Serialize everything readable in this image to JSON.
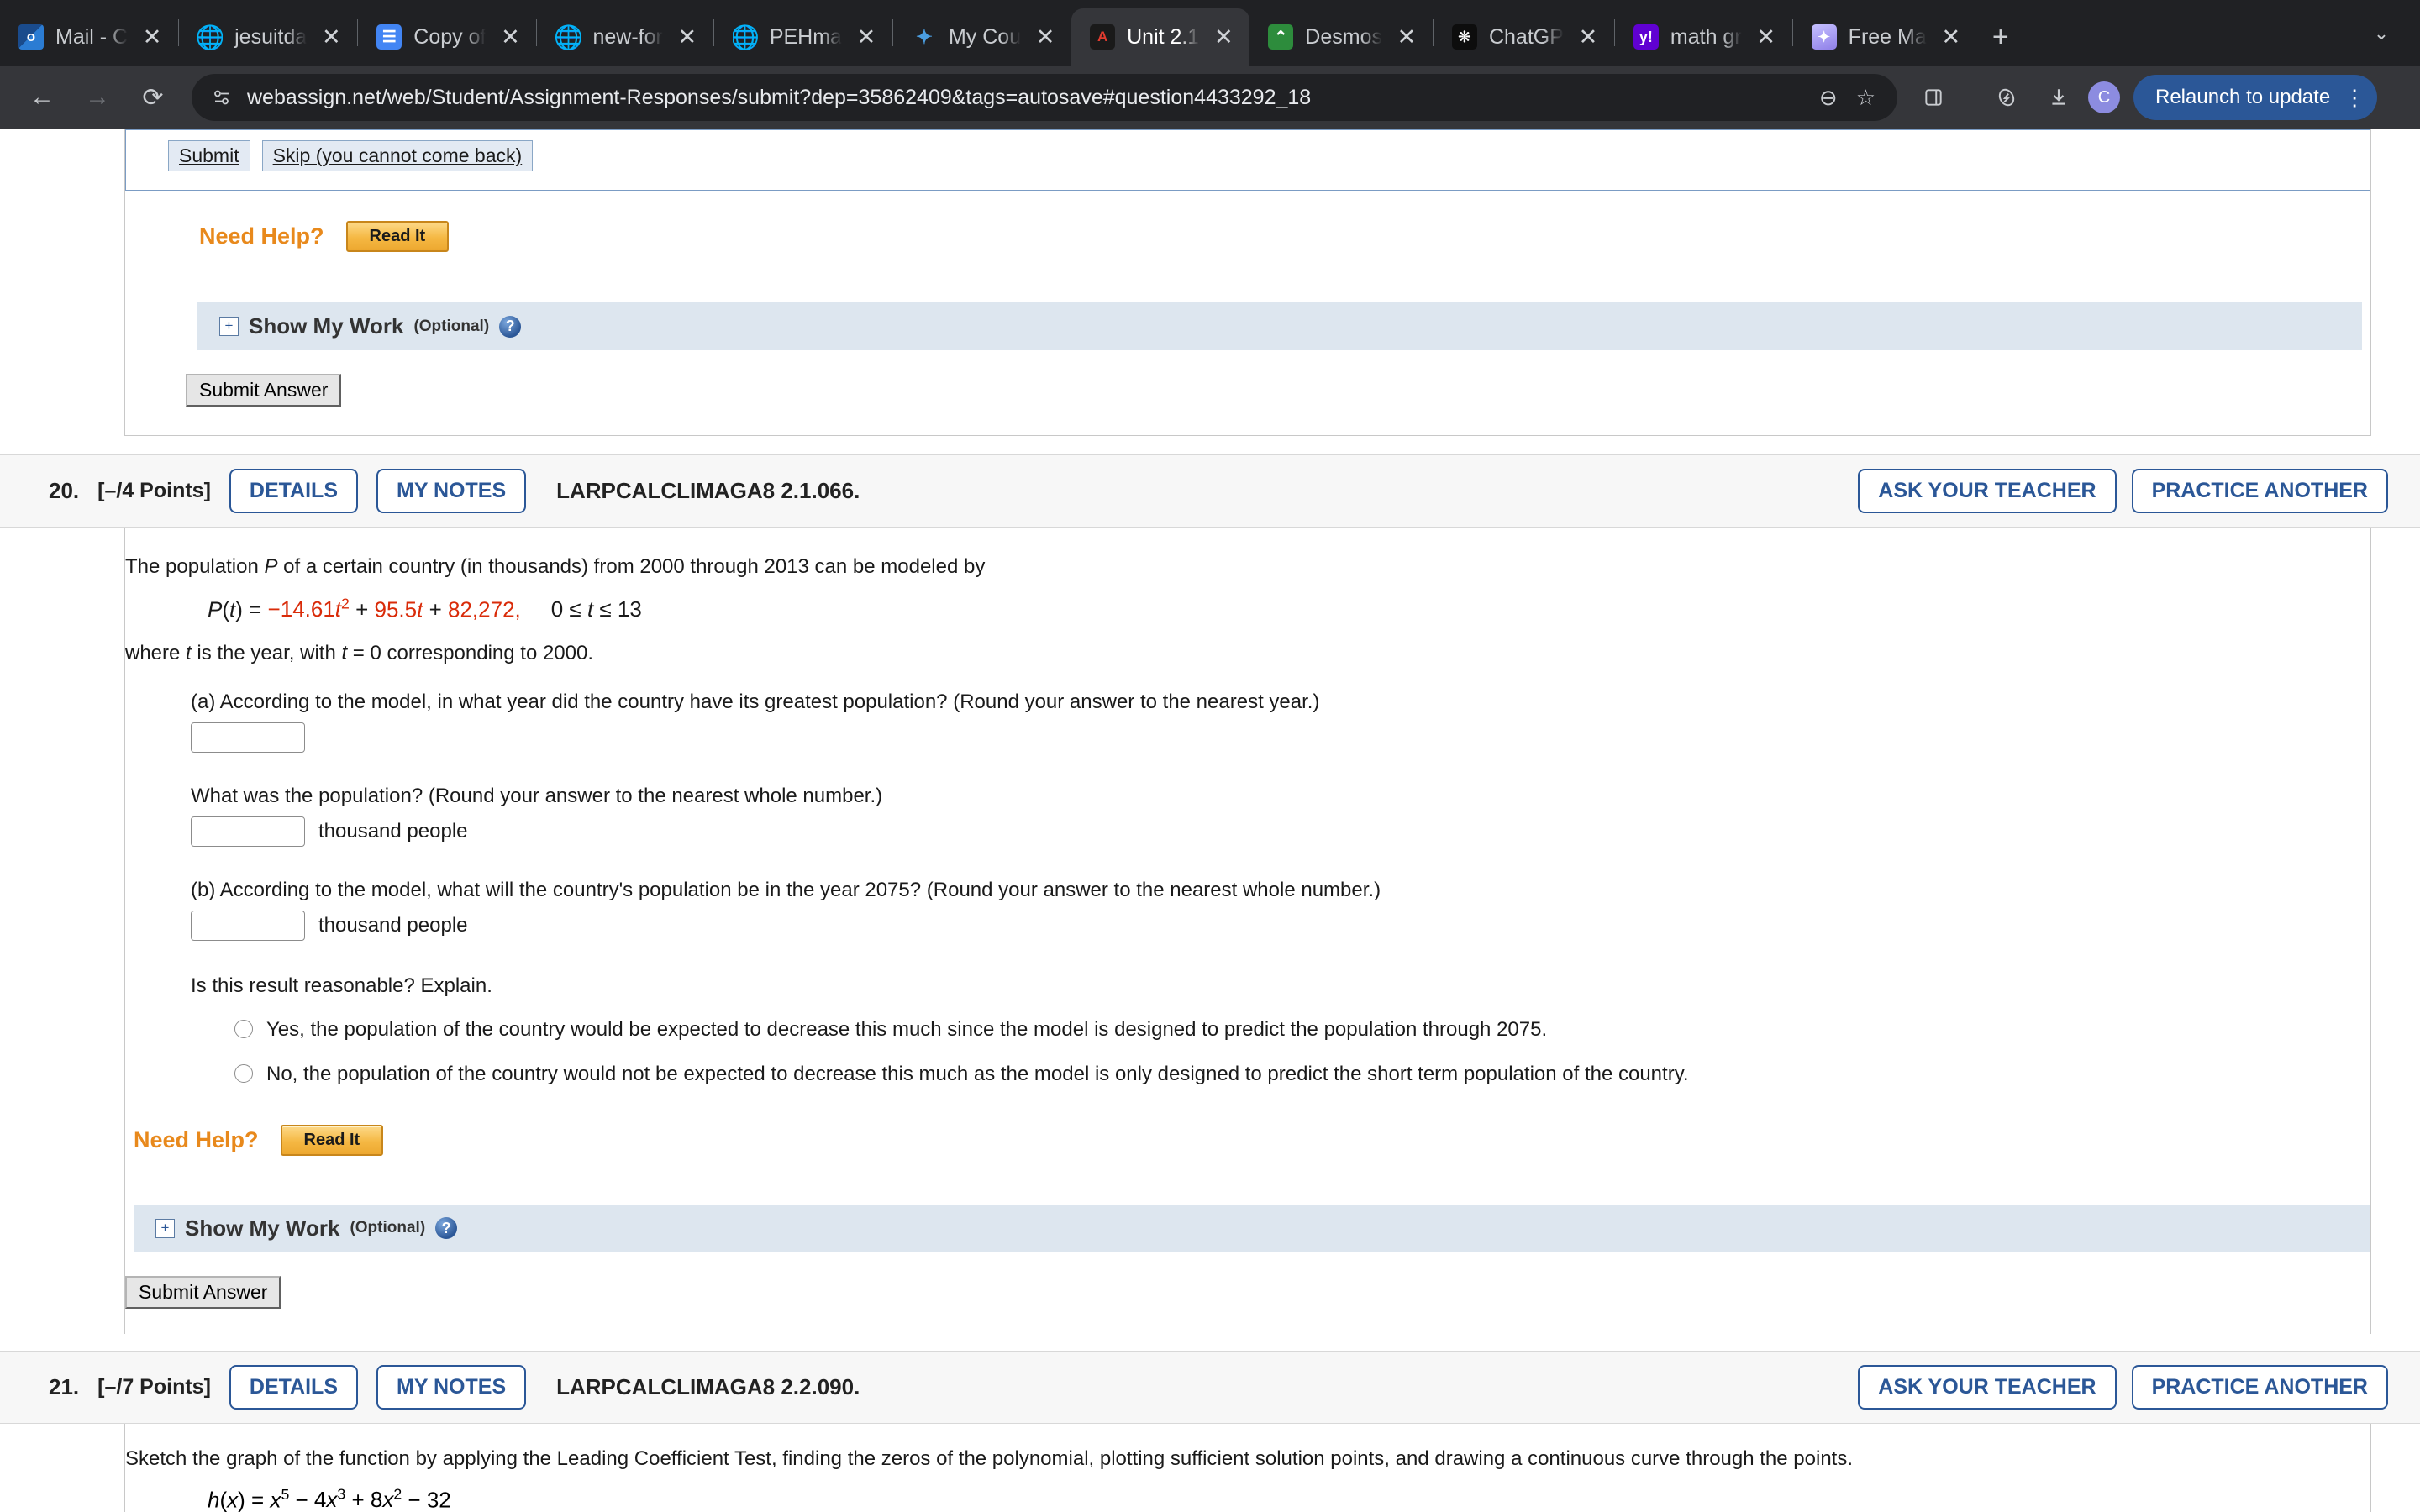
{
  "browser": {
    "tabs": [
      {
        "title": "Mail - C",
        "favicon": "outlook-icon",
        "active": false
      },
      {
        "title": "jesuitda",
        "favicon": "globe-icon",
        "active": false
      },
      {
        "title": "Copy of",
        "favicon": "google-docs-icon",
        "active": false
      },
      {
        "title": "new-for",
        "favicon": "globe-icon",
        "active": false
      },
      {
        "title": "PEHma",
        "favicon": "globe-icon",
        "active": false
      },
      {
        "title": "My Cou",
        "favicon": "canvas-icon",
        "active": false
      },
      {
        "title": "Unit 2.1",
        "favicon": "webassign-icon",
        "active": true
      },
      {
        "title": "Desmos",
        "favicon": "desmos-icon",
        "active": false
      },
      {
        "title": "ChatGP",
        "favicon": "chatgpt-icon",
        "active": false
      },
      {
        "title": "math gr",
        "favicon": "yahoo-icon",
        "active": false
      },
      {
        "title": "Free Ma",
        "favicon": "gemini-icon",
        "active": false
      }
    ],
    "new_tab_label": "+",
    "tab_list_chevron": "⌄",
    "nav": {
      "back": "←",
      "forward": "→",
      "reload": "⟳"
    },
    "omnibox": {
      "site_icon": "permissions-icon",
      "url": "webassign.net/web/Student/Assignment-Responses/submit?dep=35862409&tags=autosave#question4433292_18",
      "zoom_icon": "⊖",
      "bookmark_icon": "☆"
    },
    "toolbar_icons": [
      "side-panel-icon",
      "extensions-icon",
      "downloads-icon"
    ],
    "profile_initial": "C",
    "relaunch_label": "Relaunch to update",
    "menu_icon": "⋮",
    "colors": {
      "chrome_bg": "#202124",
      "toolbar_bg": "#35363a",
      "relaunch_bg": "#2b5797",
      "profile_bg": "#8c8ce0"
    }
  },
  "prev_question": {
    "submit_label": "Submit",
    "skip_label": "Skip (you cannot come back)",
    "need_help_label": "Need Help?",
    "read_it_label": "Read It",
    "show_my_work": {
      "expander": "+",
      "title": "Show My Work",
      "optional": "(Optional)",
      "help": "?"
    },
    "submit_answer_label": "Submit Answer"
  },
  "question20": {
    "number": "20.",
    "points": "[–/4 Points]",
    "details_label": "DETAILS",
    "my_notes_label": "MY NOTES",
    "code": "LARPCALCLIMAGA8 2.1.066.",
    "ask_teacher_label": "ASK YOUR TEACHER",
    "practice_another_label": "PRACTICE ANOTHER",
    "intro": "The population P of a certain country (in thousands) from 2000 through 2013 can be modeled by",
    "equation": {
      "lhs": "P(t) = ",
      "term1": "−14.61t",
      "term1_exp": "2",
      "plus1": " + ",
      "term2": "95.5t",
      "plus2": " + ",
      "term3": "82,272,",
      "domain": "0 ≤ t ≤ 13"
    },
    "where_text": "where t is the year, with  t = 0  corresponding to 2000.",
    "part_a": "(a) According to the model, in what year did the country have its greatest population? (Round your answer to the nearest year.)",
    "part_a_value": "",
    "part_a2": "What was the population? (Round your answer to the nearest whole number.)",
    "part_a2_value": "",
    "part_a2_unit": "thousand people",
    "part_b": "(b) According to the model, what will the country's population be in the year 2075? (Round your answer to the nearest whole number.)",
    "part_b_value": "",
    "part_b_unit": "thousand people",
    "reasonable_prompt": "Is this result reasonable? Explain.",
    "options": [
      "Yes, the population of the country would be expected to decrease this much since the model is designed to predict the population through 2075.",
      "No, the population of the country would not be expected to decrease this much as the model is only designed to predict the short term population of the country."
    ],
    "need_help_label": "Need Help?",
    "read_it_label": "Read It",
    "show_my_work": {
      "expander": "+",
      "title": "Show My Work",
      "optional": "(Optional)",
      "help": "?"
    },
    "submit_answer_label": "Submit Answer"
  },
  "question21": {
    "number": "21.",
    "points": "[–/7 Points]",
    "details_label": "DETAILS",
    "my_notes_label": "MY NOTES",
    "code": "LARPCALCLIMAGA8 2.2.090.",
    "ask_teacher_label": "ASK YOUR TEACHER",
    "practice_another_label": "PRACTICE ANOTHER",
    "intro": "Sketch the graph of the function by applying the Leading Coefficient Test, finding the zeros of the polynomial, plotting sufficient solution points, and drawing a continuous curve through the points.",
    "equation": {
      "lhs": "h(x) = x",
      "exp1": "5",
      "mid1": " − ",
      "term2": "4x",
      "exp2": "3",
      "mid2": " + ",
      "term3": "8x",
      "exp3": "2",
      "mid3": " − ",
      "term4": "32"
    }
  },
  "colors": {
    "accent_blue": "#2b5797",
    "orange": "#e8891c",
    "equation_red": "#d92b09",
    "panel_blue": "#dde6ef"
  }
}
